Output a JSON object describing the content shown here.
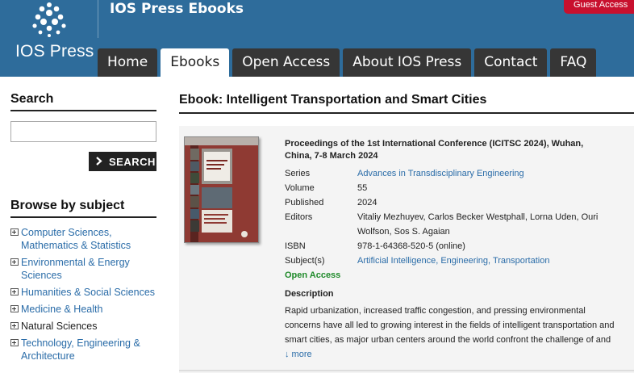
{
  "header": {
    "brand": "IOS Press",
    "site_title": "IOS Press Ebooks",
    "guest_button": "Guest Access",
    "colors": {
      "header_bg": "#2e6c9b",
      "nav_tab": "#363636",
      "guest_button": "#c8102e"
    }
  },
  "nav": {
    "tabs": [
      {
        "label": "Home",
        "active": false
      },
      {
        "label": "Ebooks",
        "active": true
      },
      {
        "label": "Open Access",
        "active": false
      },
      {
        "label": "About IOS Press",
        "active": false
      },
      {
        "label": "Contact",
        "active": false
      },
      {
        "label": "FAQ",
        "active": false
      }
    ]
  },
  "sidebar": {
    "search_heading": "Search",
    "search_value": "",
    "search_button": "SEARCH",
    "browse_heading": "Browse by subject",
    "subjects": [
      {
        "label": "Computer Sciences, Mathematics & Statistics",
        "link": true
      },
      {
        "label": "Environmental & Energy Sciences",
        "link": true
      },
      {
        "label": "Humanities & Social Sciences",
        "link": true
      },
      {
        "label": "Medicine & Health",
        "link": true
      },
      {
        "label": "Natural Sciences",
        "link": false
      },
      {
        "label": "Technology, Engineering & Architecture",
        "link": true
      }
    ]
  },
  "main": {
    "title": "Ebook: Intelligent Transportation and Smart Cities",
    "proceedings_title": "Proceedings of the 1st International Conference (ICITSC 2024), Wuhan, China, 7-8 March 2024",
    "meta": {
      "series_label": "Series",
      "series_value": "Advances in Transdisciplinary Engineering",
      "volume_label": "Volume",
      "volume_value": "55",
      "published_label": "Published",
      "published_value": "2024",
      "editors_label": "Editors",
      "editors_value": "Vitaliy Mezhuyev, Carlos Becker Westphall, Lorna Uden, Ouri Wolfson, Sos S. Agaian",
      "isbn_label": "ISBN",
      "isbn_value": "978-1-64368-520-5 (online)",
      "subjects_label": "Subject(s)",
      "subjects_value": "Artificial Intelligence, Engineering, Transportation"
    },
    "open_access": "Open Access",
    "description_heading": "Description",
    "description": "Rapid urbanization, increased traffic congestion, and pressing environmental concerns have all led to growing interest in the fields of intelligent transportation and smart cities, as major urban centers around the world confront the challenge of and",
    "more_link": "↓ more"
  }
}
